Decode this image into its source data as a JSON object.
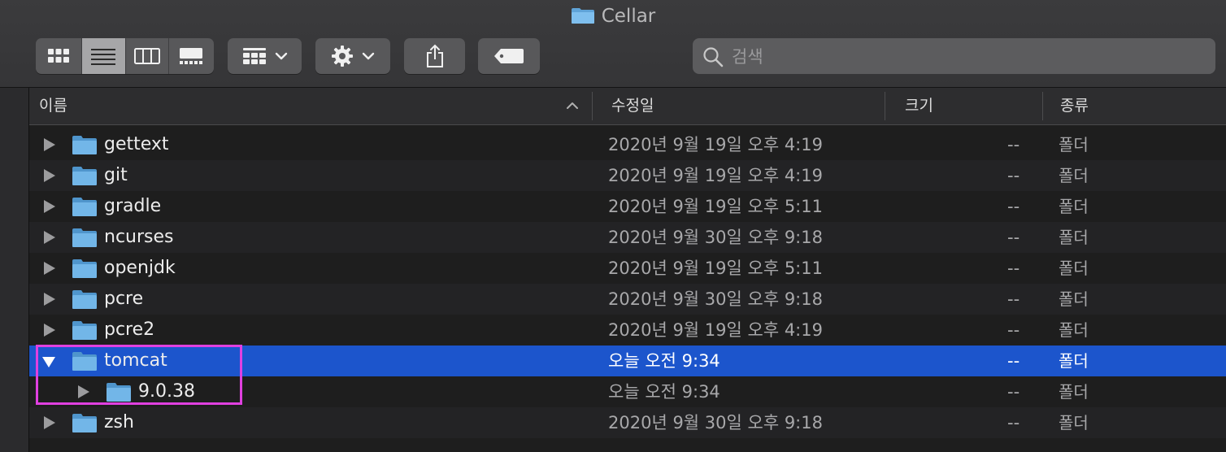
{
  "window": {
    "title": "Cellar",
    "title_icon": "folder-icon"
  },
  "toolbar": {
    "view_modes": [
      {
        "name": "icon-view",
        "icon": "grid-icon",
        "active": false
      },
      {
        "name": "list-view",
        "icon": "list-icon",
        "active": true
      },
      {
        "name": "column-view",
        "icon": "columns-icon",
        "active": false
      },
      {
        "name": "gallery-view",
        "icon": "gallery-icon",
        "active": false
      }
    ],
    "group_button_icon": "group-grid-icon",
    "action_button_icon": "gear-icon",
    "share_button_icon": "share-icon",
    "tag_button_icon": "tag-icon"
  },
  "search": {
    "placeholder": "검색",
    "value": ""
  },
  "columns": {
    "name": "이름",
    "date": "수정일",
    "size": "크기",
    "kind": "종류",
    "sort_icon": "chevron-up-icon"
  },
  "files": [
    {
      "name": "gettext",
      "date": "2020년 9월 19일 오후 4:19",
      "size": "--",
      "kind": "폴더",
      "level": 0,
      "expanded": false,
      "selected": false
    },
    {
      "name": "git",
      "date": "2020년 9월 19일 오후 4:19",
      "size": "--",
      "kind": "폴더",
      "level": 0,
      "expanded": false,
      "selected": false
    },
    {
      "name": "gradle",
      "date": "2020년 9월 19일 오후 5:11",
      "size": "--",
      "kind": "폴더",
      "level": 0,
      "expanded": false,
      "selected": false
    },
    {
      "name": "ncurses",
      "date": "2020년 9월 30일 오후 9:18",
      "size": "--",
      "kind": "폴더",
      "level": 0,
      "expanded": false,
      "selected": false
    },
    {
      "name": "openjdk",
      "date": "2020년 9월 19일 오후 5:11",
      "size": "--",
      "kind": "폴더",
      "level": 0,
      "expanded": false,
      "selected": false
    },
    {
      "name": "pcre",
      "date": "2020년 9월 30일 오후 9:18",
      "size": "--",
      "kind": "폴더",
      "level": 0,
      "expanded": false,
      "selected": false
    },
    {
      "name": "pcre2",
      "date": "2020년 9월 19일 오후 4:19",
      "size": "--",
      "kind": "폴더",
      "level": 0,
      "expanded": false,
      "selected": false
    },
    {
      "name": "tomcat",
      "date": "오늘 오전 9:34",
      "size": "--",
      "kind": "폴더",
      "level": 0,
      "expanded": true,
      "selected": true
    },
    {
      "name": "9.0.38",
      "date": "오늘 오전 9:34",
      "size": "--",
      "kind": "폴더",
      "level": 1,
      "expanded": false,
      "selected": false
    },
    {
      "name": "zsh",
      "date": "2020년 9월 30일 오후 9:18",
      "size": "--",
      "kind": "폴더",
      "level": 0,
      "expanded": false,
      "selected": false
    }
  ],
  "colors": {
    "selection": "#1c55cc",
    "folder": "#6fb4e6",
    "annotation": "#e040e0"
  }
}
